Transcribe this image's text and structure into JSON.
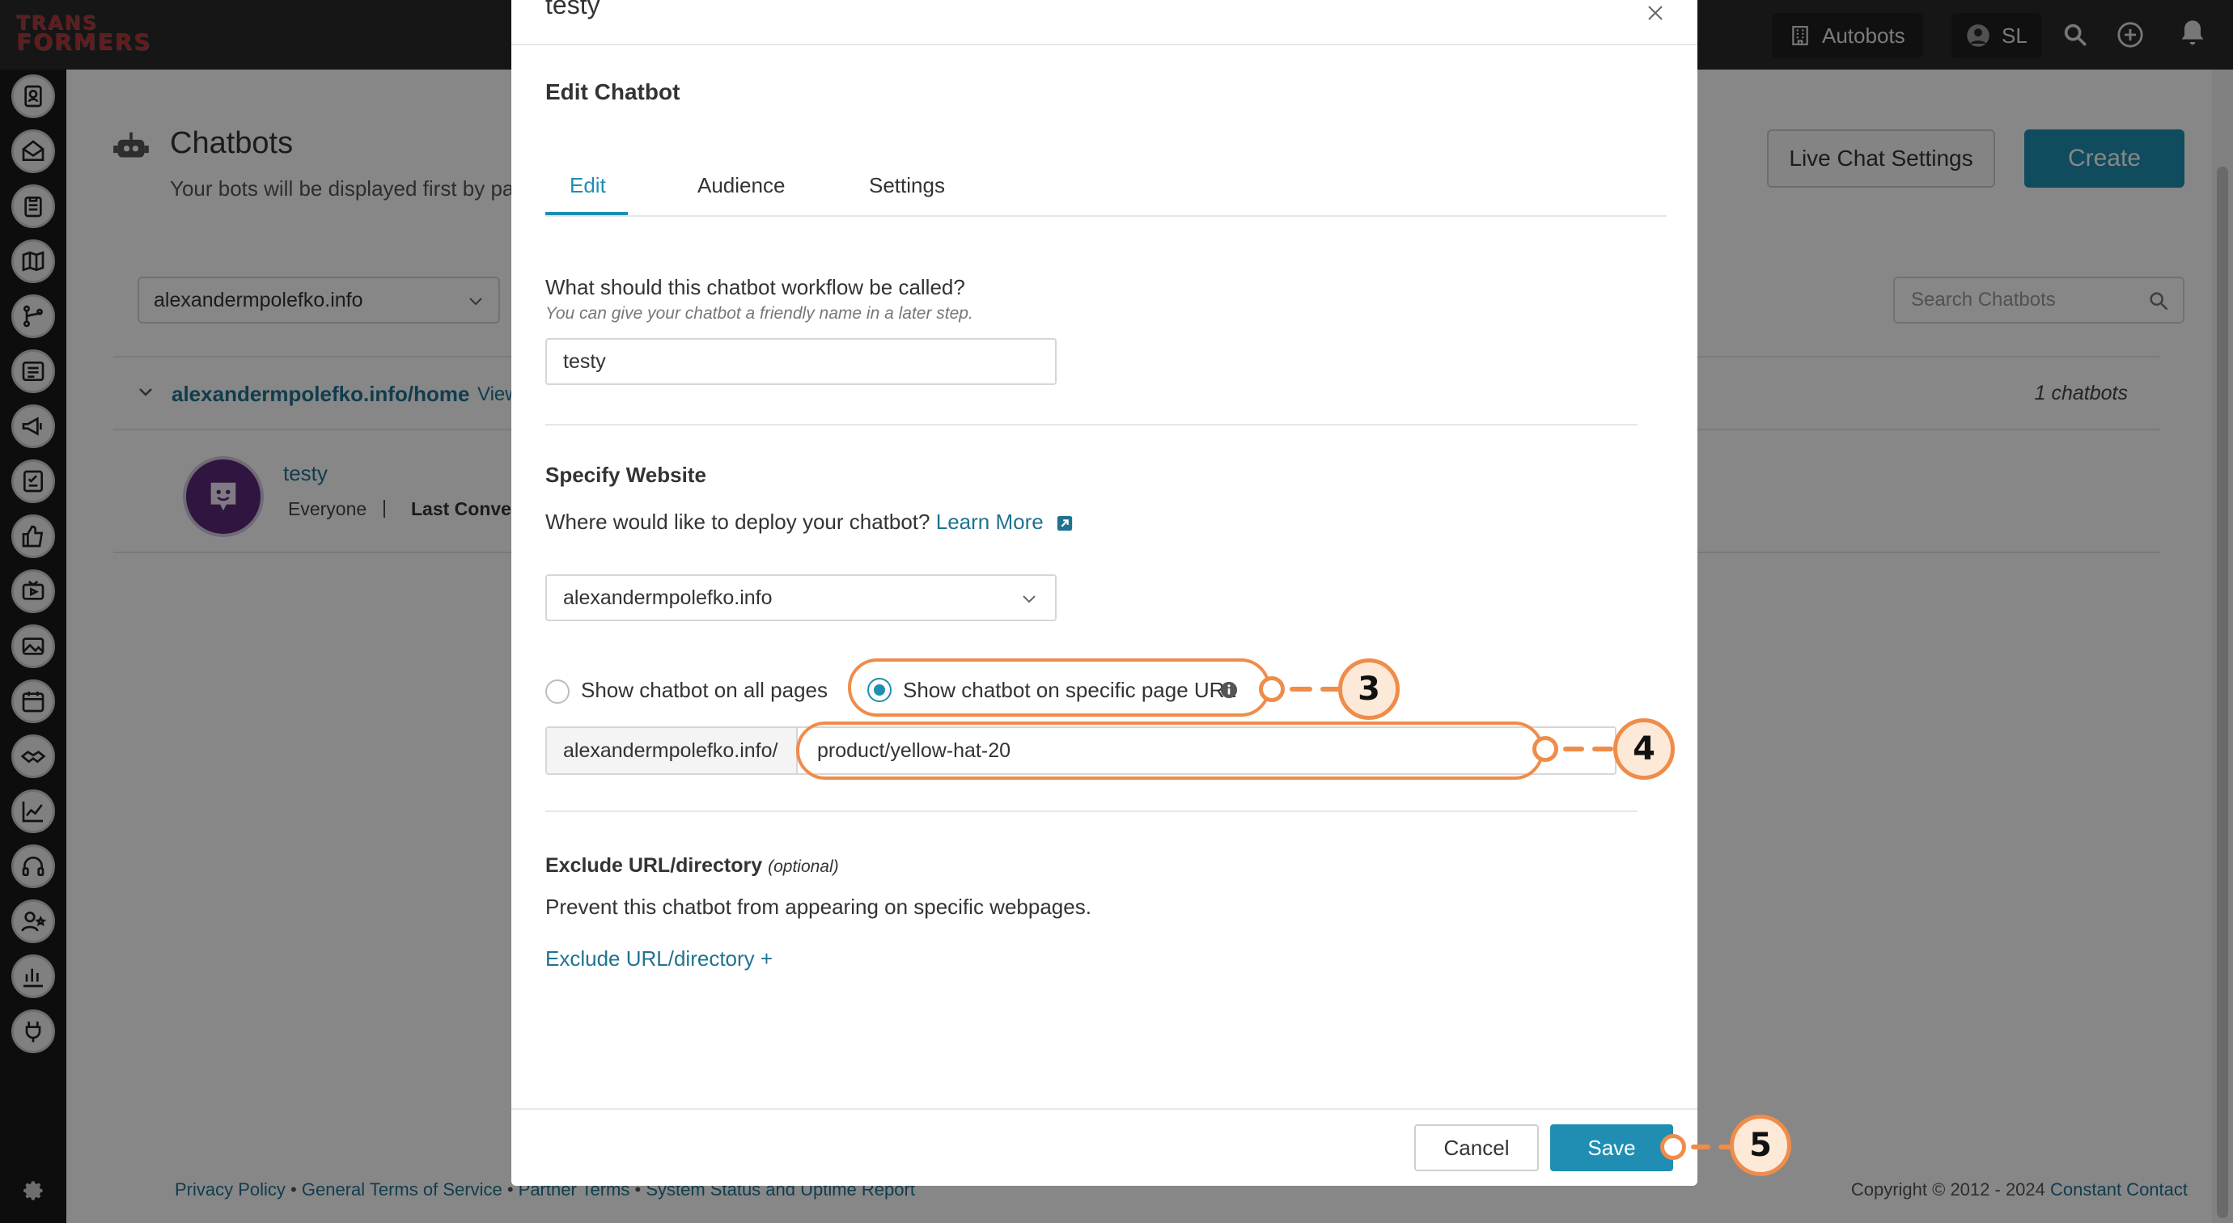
{
  "app": {
    "logo_text_top": "TRANS",
    "logo_text_bottom": "FORMERS",
    "account_label": "Autobots",
    "user_initials": "SL"
  },
  "page": {
    "title": "Chatbots",
    "subtitle": "Your bots will be displayed first by page",
    "live_chat_settings": "Live Chat Settings",
    "create": "Create",
    "domain_filter": "alexandermpolefko.info",
    "search_placeholder": "Search Chatbots",
    "group": {
      "name": "alexandermpolefko.info/home",
      "view": "View",
      "count": "1 chatbots"
    },
    "bot": {
      "name": "testy",
      "audience": "Everyone",
      "separator": "|",
      "last_conversation": "Last Convers"
    }
  },
  "footer": {
    "links": [
      "Privacy Policy",
      "General Terms of Service",
      "Partner Terms",
      "System Status and Uptime Report"
    ],
    "separator": "•",
    "copyright": "Copyright © 2012 - 2024",
    "company": "Constant Contact"
  },
  "modal": {
    "top_title": "testy",
    "heading": "Edit Chatbot",
    "tabs": [
      {
        "label": "Edit",
        "active": true
      },
      {
        "label": "Audience",
        "active": false
      },
      {
        "label": "Settings",
        "active": false
      }
    ],
    "name_question": "What should this chatbot workflow be called?",
    "name_hint": "You can give your chatbot a friendly name in a later step.",
    "name_value": "testy",
    "website_title": "Specify Website",
    "website_question": "Where would like to deploy your chatbot?",
    "learn_more": "Learn More",
    "website_value": "alexandermpolefko.info",
    "radio_all_pages": "Show chatbot on all pages",
    "radio_specific_url": "Show chatbot on specific page URL",
    "selected_radio": "specific_url",
    "url_prefix": "alexandermpolefko.info/",
    "url_value": "product/yellow-hat-20",
    "exclude_title": "Exclude URL/directory",
    "exclude_optional": "(optional)",
    "exclude_desc": "Prevent this chatbot from appearing on specific webpages.",
    "exclude_link": "Exclude URL/directory +",
    "cancel": "Cancel",
    "save": "Save"
  },
  "callouts": [
    "3",
    "4",
    "5"
  ],
  "colors": {
    "accent": "#1f8eb2",
    "link": "#1f7391",
    "callout": "#f08c4a",
    "callout_fill": "#fde9d8",
    "topbar": "#2b2b2b"
  },
  "icons": {
    "sidebar": [
      "contacts-icon",
      "email-icon",
      "clipboard-icon",
      "map-icon",
      "flow-icon",
      "list-icon",
      "megaphone-icon",
      "survey-icon",
      "thumbs-up-icon",
      "video-icon",
      "image-icon",
      "calendar-icon",
      "handshake-icon",
      "chart-icon",
      "headset-icon",
      "person-star-icon",
      "bar-chart-icon",
      "plug-icon"
    ]
  }
}
